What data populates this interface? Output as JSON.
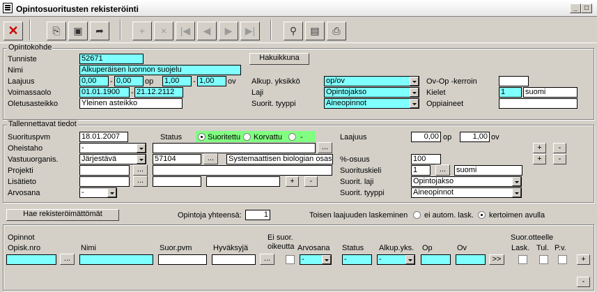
{
  "window": {
    "title": "Opintosuoritusten rekisteröinti",
    "min": "_",
    "max": "□",
    "close": "×"
  },
  "toolbar": {
    "delete": "✕",
    "b1": "⎘",
    "save": "▣",
    "b3": "➦",
    "add": "+",
    "remove": "×",
    "first": "|◀",
    "prev": "◀",
    "next": "▶",
    "last": "▶|",
    "search": "⚲",
    "b10": "▤",
    "print": "⎙"
  },
  "opintokohde": {
    "legend": "Opintokohde",
    "tunniste_label": "Tunniste",
    "tunniste": "52671",
    "hakuikkuna": "Hakuikkuna",
    "nimi_label": "Nimi",
    "nimi": "Alkuperäisen luonnon suojelu",
    "laajuus_label": "Laajuus",
    "laajuus_min_op": "0,00",
    "laajuus_max_op": "0,00",
    "op": "op",
    "laajuus_min_ov": "1,00",
    "laajuus_max_ov": "1,00",
    "ov": "ov",
    "dash": "-",
    "alkup_label": "Alkup. yksikkö",
    "alkup": "op/ov",
    "ovop_label": "Ov-Op -kerroin",
    "ovop": "",
    "voimassaolo_label": "Voimassaolo",
    "voimassa_from": "01.01.1900",
    "voimassa_to": "21.12.2112",
    "laji_label": "Laji",
    "laji": "Opintojakso",
    "kielet_label": "Kielet",
    "kieli_code": "1",
    "kieli": "suomi",
    "oletusasteikko_label": "Oletusasteikko",
    "oletusasteikko": "Yleinen asteikko",
    "suorit_tyyppi_label": "Suorit. tyyppi",
    "suorit_tyyppi": "Aineopinnot",
    "oppiaineet_label": "Oppiaineet",
    "oppiaineet": ""
  },
  "tallennettavat": {
    "legend": "Tallennettavat tiedot",
    "suorituspvm_label": "Suorituspvm",
    "suorituspvm": "18.01.2007",
    "status_label": "Status",
    "radio_suoritettu": "Suoritettu",
    "radio_korvattu": "Korvattu",
    "radio_dash": "-",
    "laajuus_label": "Laajuus",
    "laajuus_op": "0,00",
    "op": "op",
    "laajuus_ov": "1,00",
    "ov": "ov",
    "oheistaho_label": "Oheistaho",
    "oheistaho": "-",
    "vastuuorg_label": "Vastuuorganis.",
    "vastuuorg": "Järjestävä",
    "vastuu_code": "57104",
    "vastuu_name": "Systemaattisen biologian osasto",
    "osuus_label": "%-osuus",
    "osuus": "100",
    "projekti_label": "Projekti",
    "suorituskieli_label": "Suorituskieli",
    "suorituskieli_code": "1",
    "suorituskieli": "suomi",
    "lisatieto_label": "Lisätieto",
    "suorit_laji_label": "Suorit. laji",
    "suorit_laji": "Opintojakso",
    "arvosana_label": "Arvosana",
    "arvosana": "-",
    "suorit_tyyppi_label": "Suorit. tyyppi",
    "suorit_tyyppi": "Aineopinnot",
    "ellipsis": "...",
    "plus": "+",
    "minus": "-"
  },
  "middle": {
    "hae_button": "Hae rekisteröimättömät",
    "yhteensa_label": "Opintoja yhteensä:",
    "yhteensa": "1",
    "toisen_label": "Toisen laajuuden laskeminen",
    "radio_ei": "ei autom. lask.",
    "radio_kertoimen": "kertoimen avulla"
  },
  "opinnot": {
    "title": "Opinnot",
    "opisk_nro": "Opisk.nro",
    "nimi": "Nimi",
    "suor_pvm": "Suor.pvm",
    "hyvaksyja": "Hyväksyjä",
    "ei_suor_1": "Ei suor.",
    "ei_suor_2": "oikeutta",
    "arvosana": "Arvosana",
    "status": "Status",
    "alkup_yks": "Alkup.yks.",
    "op": "Op",
    "ov": "Ov",
    "suor_otteelle": "Suor.otteelle",
    "lask": "Lask.",
    "tul": "Tul.",
    "pv": "P.v.",
    "arvosana_val": "-",
    "status_val": "-",
    "alkup_val": "-",
    "next": ">>",
    "plus": "+",
    "minus": "-",
    "ellipsis": "..."
  }
}
